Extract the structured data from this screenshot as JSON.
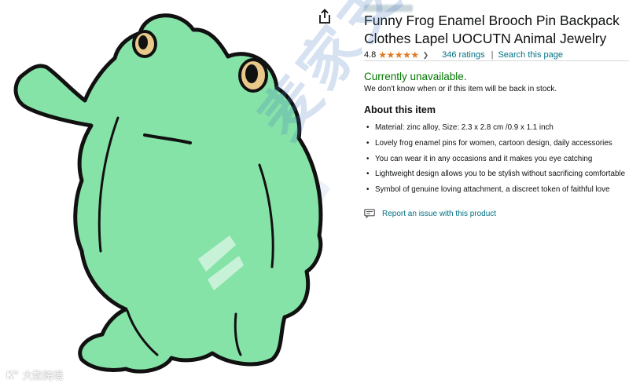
{
  "product": {
    "title_line1": "Funny Frog Enamel Brooch Pin Backpack",
    "title_line2": "Clothes Lapel UOCUTN Animal Jewelry",
    "rating": "4.8",
    "stars": "★★★★★",
    "rating_value": 4.8,
    "ratings_count": "346 ratings",
    "separator": "|",
    "search_link": "Search this page"
  },
  "availability": {
    "status": "Currently unavailable.",
    "note": "We don't know when or if this item will be back in stock."
  },
  "about": {
    "heading": "About this item",
    "bullets": [
      "Material: zinc alloy, Size: 2.3 x 2.8 cm /0.9 x 1.1 inch",
      "Lovely frog enamel pins for women, cartoon design, daily accessories",
      "You can wear it in any occasions and it makes you eye catching",
      "Lightweight design allows you to be stylish without sacrificing comfortable",
      "Symbol of genuine loving attachment, a discreet token of faithful love"
    ]
  },
  "report": {
    "label": "Report an issue with this product"
  },
  "watermark": {
    "text": "麦家支持",
    "brand": "大数跨境",
    "logo": "K°"
  },
  "icons": {
    "share": "share-icon",
    "chevron": "chevron-down-icon",
    "report": "report-flag-icon"
  },
  "colors": {
    "frog_green": "#86e3a8",
    "link": "#007185",
    "available": "#007600",
    "star": "#de7921"
  }
}
